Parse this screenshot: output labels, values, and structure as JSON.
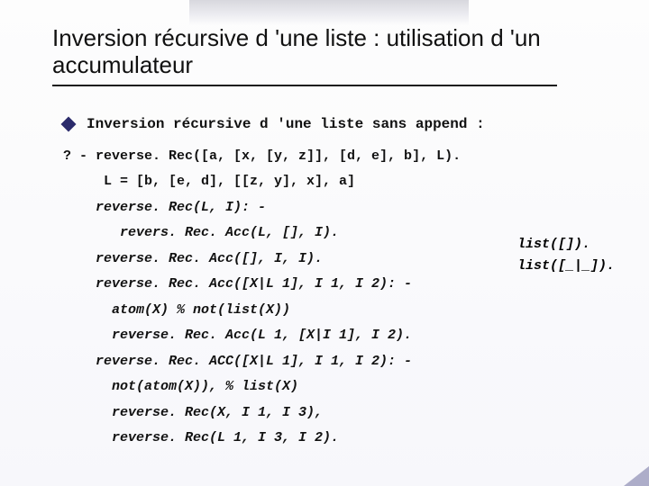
{
  "title": "Inversion récursive d 'une liste : utilisation d 'un accumulateur",
  "bullet": "Inversion récursive d 'une liste sans append :",
  "q1": "? - reverse. Rec([a, [x, [y, z]], [d, e], b], L).",
  "q2": "     L = [b, [e, d], [[z, y], x], a]",
  "c1": "    reverse. Rec(L, I): -",
  "c2": "       revers. Rec. Acc(L, [], I).",
  "c3": "    reverse. Rec. Acc([], I, I).",
  "c4": "    reverse. Rec. Acc([X|L 1], I 1, I 2): -",
  "c5": "      atom(X) % not(list(X))",
  "c6": "      reverse. Rec. Acc(L 1, [X|I 1], I 2).",
  "c7": "    reverse. Rec. ACC([X|L 1], I 1, I 2): -",
  "c8": "      not(atom(X)), % list(X)",
  "c9": "      reverse. Rec(X, I 1, I 3),",
  "c10": "      reverse. Rec(L 1, I 3, I 2).",
  "side1": "list([]).",
  "side2": "list([_|_])."
}
